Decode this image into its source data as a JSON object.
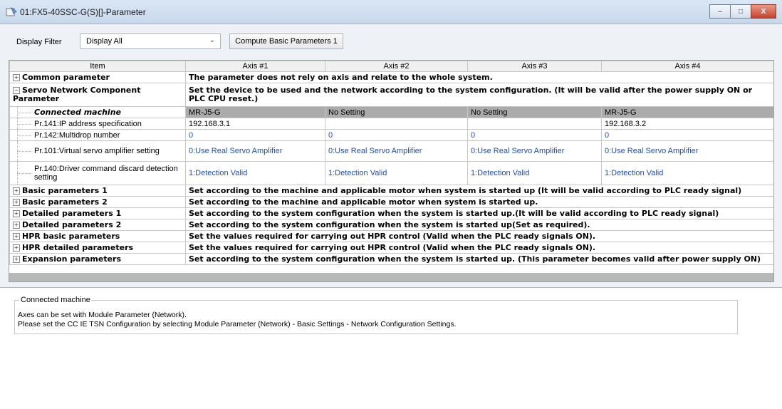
{
  "window": {
    "title": "01:FX5-40SSC-G(S)[]-Parameter",
    "minimize": "–",
    "maximize": "□",
    "close": "X"
  },
  "toolbar": {
    "filter_label": "Display Filter",
    "filter_value": "Display All",
    "compute_button": "Compute Basic Parameters 1"
  },
  "table": {
    "headers": [
      "Item",
      "Axis #1",
      "Axis #2",
      "Axis #3",
      "Axis #4"
    ],
    "common": {
      "label": "Common parameter",
      "desc": "The parameter does not rely on axis and relate to the whole system."
    },
    "servo": {
      "label": "Servo Network Component Parameter",
      "desc": "Set the device to be used and the network according to the system configuration. (It will be valid after the power supply ON or PLC CPU reset.)"
    },
    "rows": [
      {
        "label": "Connected machine",
        "v": [
          "MR-J5-G",
          "No Setting",
          "No Setting",
          "MR-J5-G"
        ]
      },
      {
        "label": "Pr.141:IP address specification",
        "v": [
          "192.168.3.1",
          "",
          "",
          "192.168.3.2"
        ]
      },
      {
        "label": "Pr.142:Multidrop number",
        "v": [
          "0",
          "0",
          "0",
          "0"
        ]
      },
      {
        "label": "Pr.101:Virtual servo amplifier setting",
        "v": [
          "0:Use Real Servo Amplifier",
          "0:Use Real Servo Amplifier",
          "0:Use Real Servo Amplifier",
          "0:Use Real Servo Amplifier"
        ]
      },
      {
        "label": "Pr.140:Driver command discard detection setting",
        "v": [
          "1:Detection Valid",
          "1:Detection Valid",
          "1:Detection Valid",
          "1:Detection Valid"
        ]
      }
    ],
    "groups": [
      {
        "label": "Basic parameters 1",
        "desc": "Set according to the machine and applicable motor when system is started up (It will be valid according to PLC ready signal)"
      },
      {
        "label": "Basic parameters 2",
        "desc": "Set according to the machine and applicable motor when system is started up."
      },
      {
        "label": "Detailed parameters 1",
        "desc": "Set according to the system configuration when the system is started up.(It will be valid according to PLC ready signal)"
      },
      {
        "label": "Detailed parameters 2",
        "desc": "Set according to the system configuration when the system is started up(Set as required)."
      },
      {
        "label": "HPR basic parameters",
        "desc": "Set the values required for carrying out HPR control (Valid when the PLC ready signals ON)."
      },
      {
        "label": "HPR detailed parameters",
        "desc": "Set the values required for carrying out HPR control (Valid when the PLC ready signals ON)."
      },
      {
        "label": "Expansion parameters",
        "desc": "Set according to the system configuration when the system is started up. (This parameter becomes valid after power supply ON)"
      }
    ]
  },
  "help": {
    "title": "Connected machine",
    "line1": "Axes can be set with Module Parameter (Network).",
    "line2": "Please set the CC IE TSN Configuration by selecting Module Parameter (Network) - Basic Settings - Network Configuration Settings."
  }
}
